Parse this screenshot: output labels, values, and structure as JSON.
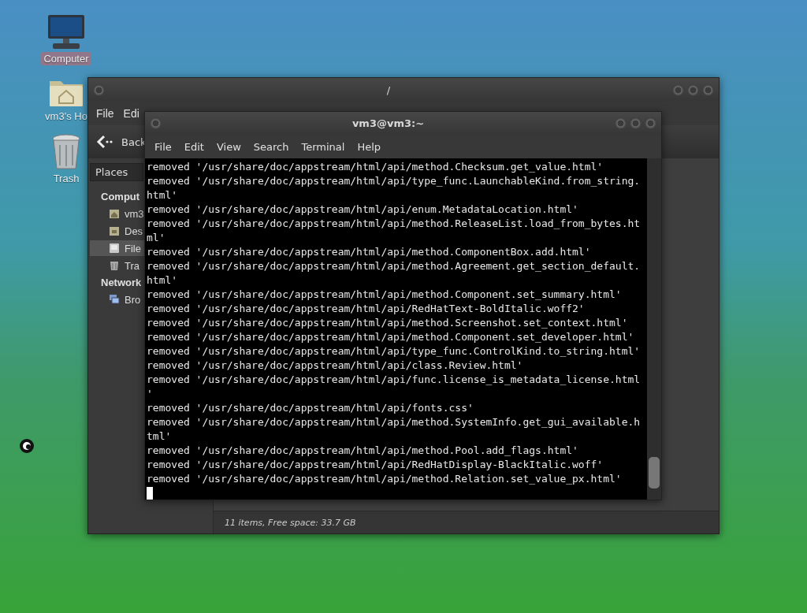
{
  "desktop": {
    "icons": [
      {
        "label": "Computer",
        "kind": "computer",
        "selected": true
      },
      {
        "label": "vm3's Ho",
        "kind": "home",
        "selected": false
      },
      {
        "label": "Trash",
        "kind": "trash",
        "selected": false
      }
    ]
  },
  "file_manager": {
    "title": "/",
    "menu": [
      "File",
      "Edi"
    ],
    "back": "Back",
    "sidebar": {
      "header": "Places",
      "sections": [
        {
          "title": "Comput",
          "items": [
            {
              "label": "vm3",
              "kind": "home",
              "selected": false
            },
            {
              "label": "Des",
              "kind": "desktop",
              "selected": false
            },
            {
              "label": "File",
              "kind": "drive",
              "selected": true
            },
            {
              "label": "Tra",
              "kind": "trash",
              "selected": false
            }
          ]
        },
        {
          "title": "Network",
          "items": [
            {
              "label": "Bro",
              "kind": "network",
              "selected": false
            }
          ]
        }
      ]
    },
    "status_bar": "11 items, Free space: 33.7 GB"
  },
  "terminal": {
    "title": "vm3@vm3:~",
    "menu": [
      "File",
      "Edit",
      "View",
      "Search",
      "Terminal",
      "Help"
    ],
    "lines": [
      "removed '/usr/share/doc/appstream/html/api/method.Checksum.get_value.html'",
      "removed '/usr/share/doc/appstream/html/api/type_func.LaunchableKind.from_string.",
      "html'",
      "removed '/usr/share/doc/appstream/html/api/enum.MetadataLocation.html'",
      "removed '/usr/share/doc/appstream/html/api/method.ReleaseList.load_from_bytes.ht",
      "ml'",
      "removed '/usr/share/doc/appstream/html/api/method.ComponentBox.add.html'",
      "removed '/usr/share/doc/appstream/html/api/method.Agreement.get_section_default.",
      "html'",
      "removed '/usr/share/doc/appstream/html/api/method.Component.set_summary.html'",
      "removed '/usr/share/doc/appstream/html/api/RedHatText-BoldItalic.woff2'",
      "removed '/usr/share/doc/appstream/html/api/method.Screenshot.set_context.html'",
      "removed '/usr/share/doc/appstream/html/api/method.Component.set_developer.html'",
      "removed '/usr/share/doc/appstream/html/api/type_func.ControlKind.to_string.html'",
      "removed '/usr/share/doc/appstream/html/api/class.Review.html'",
      "removed '/usr/share/doc/appstream/html/api/func.license_is_metadata_license.html",
      "'",
      "removed '/usr/share/doc/appstream/html/api/fonts.css'",
      "removed '/usr/share/doc/appstream/html/api/method.SystemInfo.get_gui_available.h",
      "tml'",
      "removed '/usr/share/doc/appstream/html/api/method.Pool.add_flags.html'",
      "removed '/usr/share/doc/appstream/html/api/RedHatDisplay-BlackItalic.woff'",
      "removed '/usr/share/doc/appstream/html/api/method.Relation.set_value_px.html'"
    ],
    "cursor": true
  }
}
